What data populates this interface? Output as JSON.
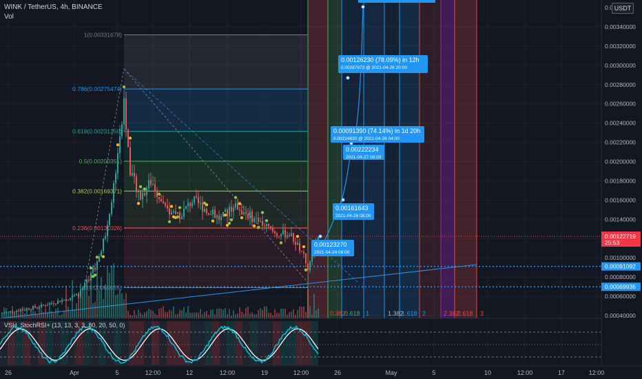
{
  "header": {
    "symbol_title": "WINK / TetherUS, 4h, BINANCE",
    "volume_label": "Vol",
    "currency_badge": "USDT",
    "oscillator_title": "VSH_StochRSI+ (13, 13, 3, 3, 80, 20, 50, 0)"
  },
  "colors": {
    "background": "#131722",
    "bull": "#26a69a",
    "bear": "#ef5350",
    "stoch_k": "#00bcd4",
    "stoch_d": "#ffffff",
    "fib_line": "#5d606b",
    "current_price_tag": "#f23645",
    "blue_line": "#2196f3",
    "annotation_bg": "#2196f3"
  },
  "chart_data": [
    {
      "type": "candlestick",
      "title": "WINK / TetherUS, 4h, BINANCE",
      "y_axis_ticks": [
        "0.00340000",
        "0.00320000",
        "0.00300000",
        "0.00280000",
        "0.00260000",
        "0.00240000",
        "0.00220000",
        "0.00200000",
        "0.00180000",
        "0.00160000",
        "0.00140000",
        "0.00120000",
        "0.00100000",
        "0.00080000",
        "0.00060000",
        "0.00040000"
      ],
      "y_axis_top_label": "0.0036",
      "ylim": [
        0.0004,
        0.00362
      ],
      "x_axis_ticks": [
        "26",
        "Apr",
        "5",
        "12:00",
        "12",
        "12:00",
        "19",
        "12:00",
        "26",
        "May",
        "5",
        "10",
        "12:00",
        "17",
        "12:00"
      ],
      "last_price": "0.00122719",
      "countdown": "25:53",
      "horizontal_levels": [
        {
          "label": "0.00091092",
          "value": 0.00091092
        },
        {
          "label": "0.00069936",
          "value": 0.00069936
        }
      ],
      "fibonacci_retracement": [
        {
          "label": "1(0.00331678)",
          "value": 0.00331678
        },
        {
          "label": "0.786(0.00275474)",
          "value": 0.00275474
        },
        {
          "label": "0.618(0.00231350)",
          "value": 0.0023135
        },
        {
          "label": "0.5(0.00200351)",
          "value": 0.00200351
        },
        {
          "label": "0.382(0.00169371)",
          "value": 0.00169371
        },
        {
          "label": "0.236(0.00131026)",
          "value": 0.00131026
        },
        {
          "label": "0(0.00069035)",
          "value": 0.00069035
        }
      ],
      "fib_time_zone_labels": [
        "0.382",
        "0.618",
        "1",
        "1.382",
        "1.618",
        "2",
        "2.382",
        "2.618",
        "3"
      ],
      "annotations": [
        {
          "text": "0.00123270",
          "sub": "2021-04-24 08:00",
          "value": 0.0012327
        },
        {
          "text": "0.00161643",
          "sub": "2021-04-26 08:00",
          "value": 0.00161643
        },
        {
          "text": "0.00222234",
          "sub": "2021-04-27 08:00",
          "value": 0.00222234
        },
        {
          "text": "0.00091390 (74.14%) in 1d 20h",
          "sub": "0.00214630 @ 2021-04-26 04:00",
          "value": 0.0021463
        },
        {
          "text": "0.00126230 (78.09%) in 12h",
          "sub": "0.00287873 @ 2021-04-26 20:00",
          "value": 0.00287873
        }
      ]
    },
    {
      "type": "line",
      "title": "VSH_StochRSI+ (13, 13, 3, 3, 80, 20, 50, 0)",
      "y_axis_ticks": [
        "80.00000000",
        "60.00000000",
        "40.00000000",
        "20.00000000"
      ],
      "ylim": [
        0,
        100
      ]
    }
  ]
}
